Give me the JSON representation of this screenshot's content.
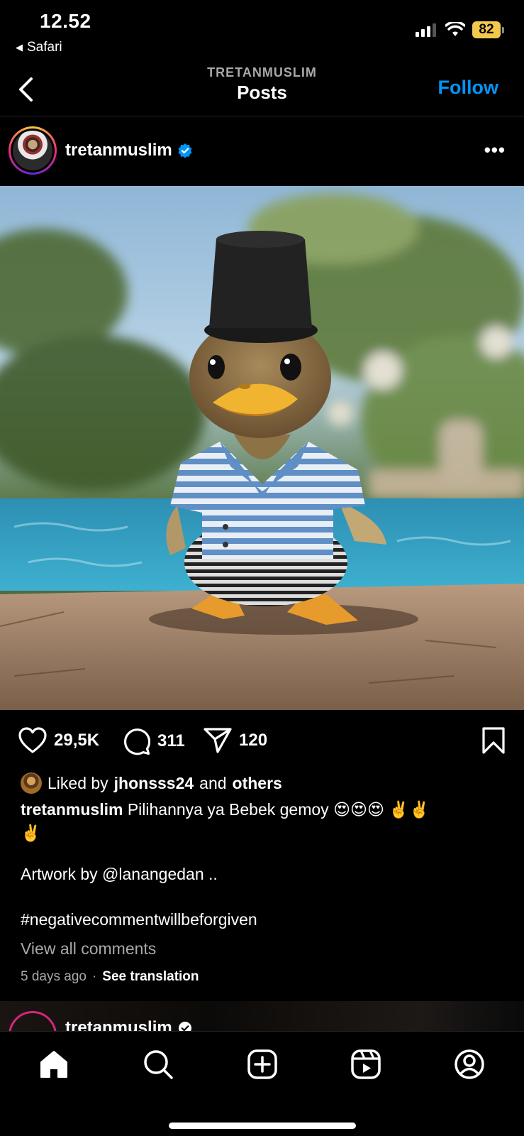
{
  "status_bar": {
    "time": "12.52",
    "back_app": "Safari",
    "battery_level": "82"
  },
  "nav": {
    "subtitle": "TRETANMUSLIM",
    "title": "Posts",
    "follow_label": "Follow"
  },
  "post": {
    "username": "tretanmuslim",
    "verified": true,
    "image_description_icon": "duck-illustration",
    "actions": {
      "likes": "29,5K",
      "comments": "311",
      "shares": "120"
    },
    "liked_by": {
      "prefix": "Liked by",
      "user": "jhonsss24",
      "connector": "and",
      "others": "others"
    },
    "caption": {
      "user": "tretanmuslim",
      "text": "Pilihannya ya Bebek gemoy",
      "emojis": "😍😍😍 ✌️✌️",
      "emoji_line2": "✌️",
      "artwork": "Artwork by @lanangedan ..",
      "hashtag": "#negativecommentwillbeforgiven"
    },
    "view_comments": "View all comments",
    "time_ago": "5 days ago",
    "separator": "·",
    "see_translation": "See translation"
  },
  "next_post": {
    "username": "tretanmuslim"
  },
  "colors": {
    "accent": "#0095f6",
    "battery": "#f2c94c",
    "muted": "#a8a8a8"
  }
}
